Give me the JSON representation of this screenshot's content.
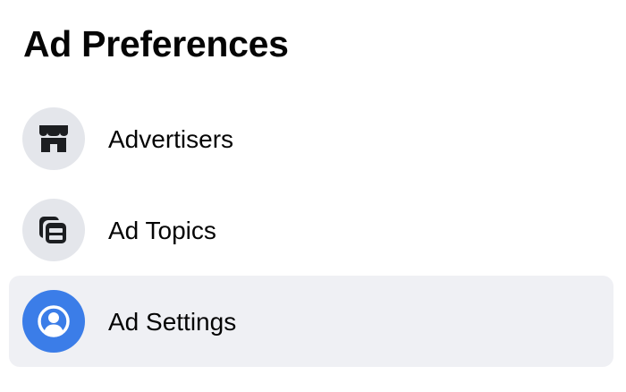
{
  "page": {
    "title": "Ad Preferences"
  },
  "menu": {
    "items": [
      {
        "label": "Advertisers",
        "icon": "storefront-icon",
        "selected": false
      },
      {
        "label": "Ad Topics",
        "icon": "cards-icon",
        "selected": false
      },
      {
        "label": "Ad Settings",
        "icon": "user-circle-icon",
        "selected": true
      }
    ]
  },
  "colors": {
    "icon_bg": "#e4e6eb",
    "selected_bg": "#eff0f4",
    "accent": "#3b7de8",
    "text": "#050505"
  }
}
